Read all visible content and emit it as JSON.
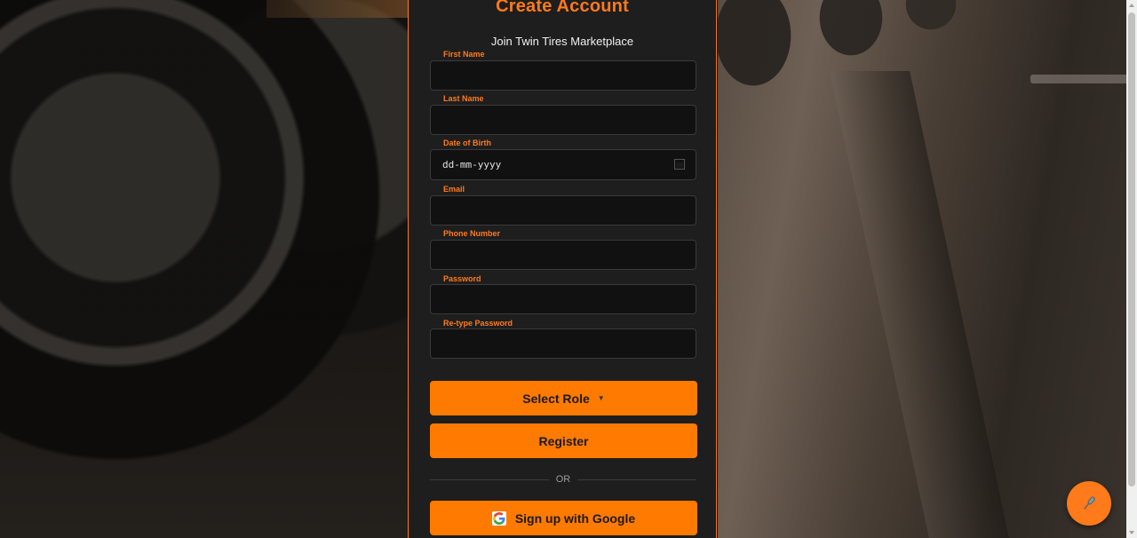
{
  "form": {
    "title": "Create Account",
    "subtitle": "Join Twin Tires Marketplace",
    "fields": {
      "first_name": {
        "label": "First Name",
        "value": ""
      },
      "last_name": {
        "label": "Last Name",
        "value": ""
      },
      "dob": {
        "label": "Date of Birth",
        "placeholder": "dd-mm-yyyy"
      },
      "email": {
        "label": "Email",
        "value": ""
      },
      "phone": {
        "label": "Phone Number",
        "value": ""
      },
      "password": {
        "label": "Password",
        "value": ""
      },
      "retype_password": {
        "label": "Re-type Password",
        "value": ""
      }
    },
    "select_role_label": "Select Role",
    "select_role_caret": "▼",
    "register_label": "Register",
    "or_text": "OR",
    "google_label": "Sign up with Google"
  },
  "colors": {
    "accent": "#ff7a00",
    "panel": "#1e1e1e",
    "input_bg": "#111111"
  },
  "icons": {
    "calendar": "calendar-icon",
    "google": "google-icon",
    "microphone": "microphone-icon"
  }
}
